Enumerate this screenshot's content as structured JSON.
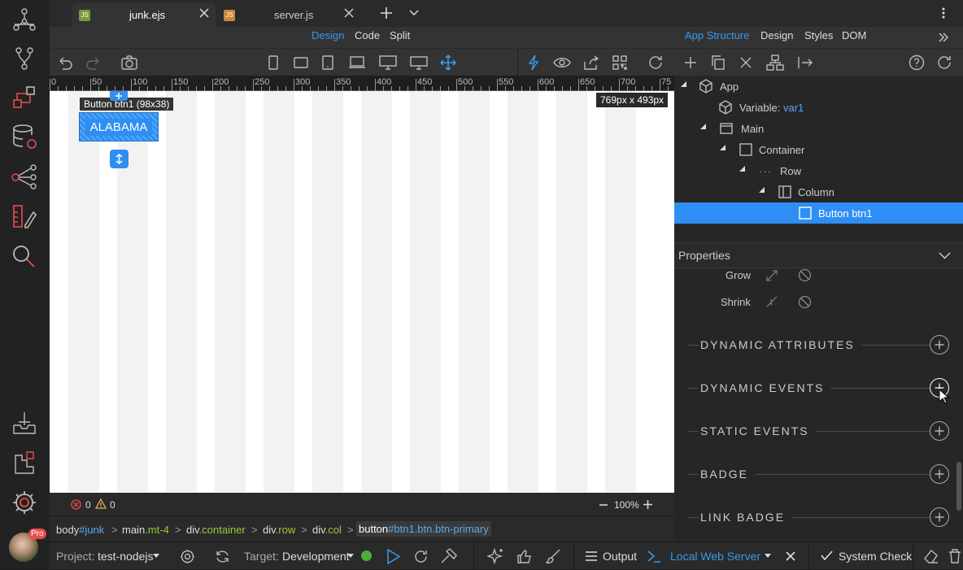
{
  "tabs": [
    {
      "label": "junk.ejs",
      "icon": "JS"
    },
    {
      "label": "server.js",
      "icon": "JS"
    }
  ],
  "modes": {
    "design": "Design",
    "code": "Code",
    "split": "Split"
  },
  "right_modes": {
    "app_structure": "App Structure",
    "design": "Design",
    "styles": "Styles",
    "dom": "DOM"
  },
  "ruler": [
    "0",
    "50",
    "100",
    "150",
    "200",
    "250",
    "300",
    "350",
    "400",
    "450",
    "500",
    "550",
    "600",
    "650",
    "700",
    "75"
  ],
  "canvas": {
    "tooltip": "Button btn1 (98x38)",
    "button_label": "ALABAMA",
    "size_badge": "769px x 493px"
  },
  "status": {
    "errors": "0",
    "warnings": "0",
    "zoom": "100%"
  },
  "breadcrumb": [
    {
      "a": "body",
      "b": "#junk"
    },
    {
      "a": "main",
      "b": ".mt-4"
    },
    {
      "a": "div",
      "b": ".container"
    },
    {
      "a": "div",
      "b": ".row"
    },
    {
      "a": "div",
      "b": ".col"
    },
    {
      "a": "button",
      "b": "#btn1.btn.btn-primary"
    }
  ],
  "tree": {
    "app": "App",
    "variable_label": "Variable:",
    "variable_name": "var1",
    "main": "Main",
    "container": "Container",
    "row": "Row",
    "column": "Column",
    "button": "Button btn1"
  },
  "properties": {
    "title": "Properties",
    "grow": "Grow",
    "shrink": "Shrink",
    "sections": [
      "DYNAMIC ATTRIBUTES",
      "DYNAMIC EVENTS",
      "STATIC EVENTS",
      "BADGE",
      "LINK BADGE"
    ]
  },
  "bottom": {
    "project_label": "Project:",
    "project": "test-nodejs",
    "target_label": "Target:",
    "target": "Development",
    "output": "Output",
    "server": "Local Web Server",
    "system_check": "System Check"
  },
  "colors": {
    "accent": "#2f8ef3",
    "green": "#98c93c",
    "blue": "#5aa9ef",
    "error": "#e84c4c",
    "warning": "#e8b04c"
  }
}
